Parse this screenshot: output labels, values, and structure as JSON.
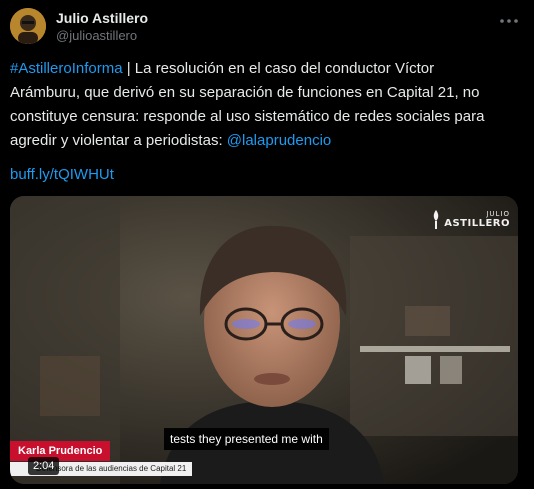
{
  "author": {
    "display_name": "Julio Astillero",
    "handle": "@julioastillero",
    "avatar_icon": "user-avatar"
  },
  "more_icon": "ellipsis-icon",
  "tweet": {
    "line1_hashtag": "#AstilleroInforma",
    "line1_rest": " | La resolución en el caso del conductor Víctor",
    "line2": "Arámburu, que derivó en su separación de funciones en Capital 21, no",
    "line3": "constituye censura: responde al uso sistemático de redes sociales para",
    "line4_text": "agredir y violentar a periodistas: ",
    "line4_mention": "@lalaprudencio",
    "short_link": "buff.ly/tQIWHUt"
  },
  "video": {
    "watermark_top": "JULIO",
    "watermark_main": "ASTILLERO",
    "lower_third_name": "Karla Prudencio",
    "lower_third_role": "Defensora de las audiencias de Capital 21",
    "subtitle": "tests they presented me with",
    "timecode": "2:04"
  },
  "colors": {
    "background": "#000000",
    "text": "#e7e9ea",
    "muted": "#71767b",
    "link": "#1d9bf0",
    "lower_third_red": "#c8102e"
  }
}
